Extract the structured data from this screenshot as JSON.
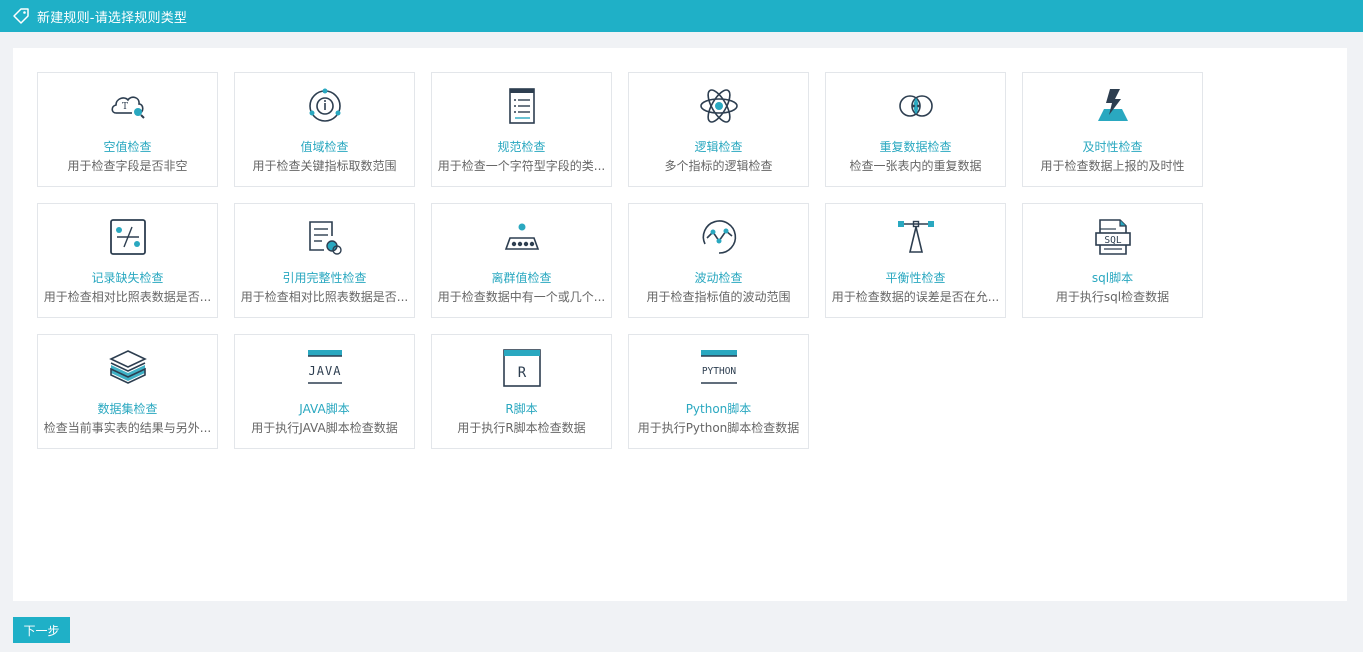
{
  "header": {
    "title": "新建规则-请选择规则类型",
    "icon": "tag-icon"
  },
  "theme": {
    "accent": "#1fb0c7",
    "card_title": "#2aa8c0",
    "icon_dark": "#2d3e50"
  },
  "rules": [
    {
      "name": "空值检查",
      "desc": "用于检查字段是否非空",
      "icon": "cloud-search-icon"
    },
    {
      "name": "值域检查",
      "desc": "用于检查关键指标取数范围",
      "icon": "range-info-icon"
    },
    {
      "name": "规范检查",
      "desc": "用于检查一个字符型字段的类...",
      "icon": "document-list-icon"
    },
    {
      "name": "逻辑检查",
      "desc": "多个指标的逻辑检查",
      "icon": "atom-icon"
    },
    {
      "name": "重复数据检查",
      "desc": "检查一张表内的重复数据",
      "icon": "overlap-circles-icon"
    },
    {
      "name": "及时性检查",
      "desc": "用于检查数据上报的及时性",
      "icon": "lightning-icon"
    },
    {
      "name": "记录缺失检查",
      "desc": "用于检查相对比照表数据是否...",
      "icon": "percent-toggle-icon"
    },
    {
      "name": "引用完整性检查",
      "desc": "用于检查相对比照表数据是否...",
      "icon": "link-document-icon"
    },
    {
      "name": "离群值检查",
      "desc": "用于检查数据中有一个或几个...",
      "icon": "outlier-dots-icon"
    },
    {
      "name": "波动检查",
      "desc": "用于检查指标值的波动范围",
      "icon": "wave-circle-icon"
    },
    {
      "name": "平衡性检查",
      "desc": "用于检查数据的误差是否在允...",
      "icon": "balance-icon"
    },
    {
      "name": "sql脚本",
      "desc": "用于执行sql检查数据",
      "icon": "sql-file-icon"
    },
    {
      "name": "数据集检查",
      "desc": "检查当前事实表的结果与另外...",
      "icon": "layers-icon"
    },
    {
      "name": "JAVA脚本",
      "desc": "用于执行JAVA脚本检查数据",
      "icon": "java-icon"
    },
    {
      "name": "R脚本",
      "desc": "用于执行R脚本检查数据",
      "icon": "r-script-icon"
    },
    {
      "name": "Python脚本",
      "desc": "用于执行Python脚本检查数据",
      "icon": "python-icon"
    }
  ],
  "footer": {
    "next_label": "下一步"
  }
}
